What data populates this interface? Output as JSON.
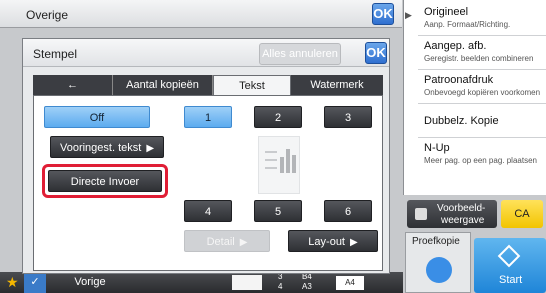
{
  "top": {
    "title": "Overige",
    "ok_label": "OK"
  },
  "dialog": {
    "title": "Stempel",
    "ok_label": "OK",
    "clear_all": "Alles annuleren",
    "tabs": [
      {
        "label": "←",
        "icon": "back-arrow-icon"
      },
      {
        "label": "Aantal kopieën"
      },
      {
        "label": "Tekst",
        "active": true
      },
      {
        "label": "Watermerk"
      }
    ],
    "left_buttons": {
      "off": "Off",
      "preset": "Vooringest. tekst",
      "direct": "Directe Invoer"
    },
    "positions": {
      "p1": "1",
      "p2": "2",
      "p3": "3",
      "p4": "4",
      "p5": "5",
      "p6": "6"
    },
    "detail": "Detail",
    "layout": "Lay-out"
  },
  "right_menu": [
    {
      "title": "Origineel",
      "sub": "Aanp. Formaat/Richting."
    },
    {
      "title": "Aangep. afb.",
      "sub": "Geregistr. beelden combineren"
    },
    {
      "title": "Patroonafdruk",
      "sub": "Onbevoegd kopiëren voorkomen"
    },
    {
      "title": "Dubbelz. Kopie",
      "sub": ""
    },
    {
      "title": "N-Up",
      "sub": "Meer pag. op een pag. plaatsen"
    }
  ],
  "preview": {
    "line1": "Voorbeeld-",
    "line2": "weergave"
  },
  "ca": "CA",
  "proefkopie": "Proefkopie",
  "start": "Start",
  "bottom": {
    "back": "Vorige",
    "tray_nums": [
      "3",
      "4"
    ],
    "tray_sizes": [
      "B4",
      "A3"
    ],
    "paper": "A4"
  },
  "colors": {
    "accent_blue": "#3a8ee6",
    "highlight": "#e01e35",
    "start": "#2f93e0",
    "ca": "#f5cc16"
  }
}
